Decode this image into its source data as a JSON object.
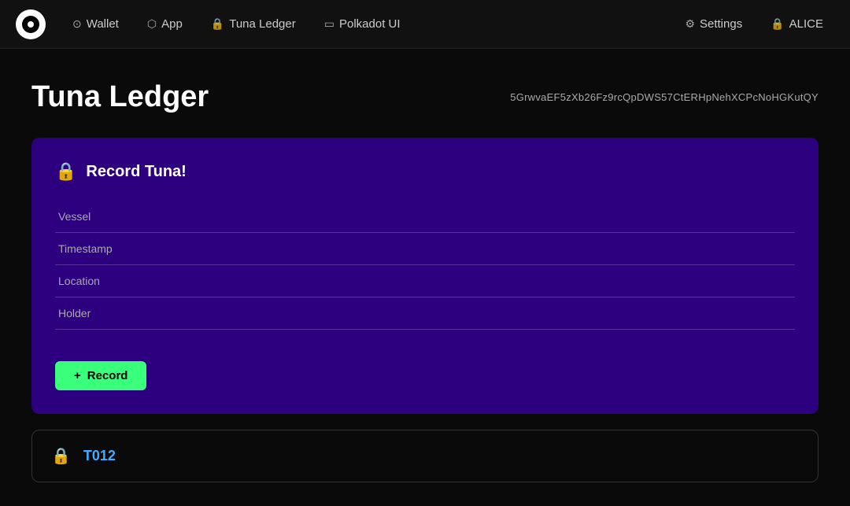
{
  "nav": {
    "logo_alt": "Polkadot Logo",
    "items": [
      {
        "id": "wallet",
        "label": "Wallet",
        "icon": "⊙"
      },
      {
        "id": "app",
        "label": "App",
        "icon": "⬡"
      },
      {
        "id": "tuna-ledger",
        "label": "Tuna Ledger",
        "icon": "🔒"
      },
      {
        "id": "polkadot-ui",
        "label": "Polkadot UI",
        "icon": "▭"
      }
    ],
    "right_items": [
      {
        "id": "settings",
        "label": "Settings",
        "icon": "⚙"
      },
      {
        "id": "alice",
        "label": "ALICE",
        "icon": "🔒"
      }
    ]
  },
  "page": {
    "title": "Tuna Ledger",
    "address": "5GrwvaEF5zXb26Fz9rcQpDWS57CtERHpNehXCPcNoHGKutQY"
  },
  "form": {
    "title": "Record Tuna!",
    "icon": "🔒",
    "fields": [
      {
        "id": "vessel",
        "placeholder": "Vessel"
      },
      {
        "id": "timestamp",
        "placeholder": "Timestamp"
      },
      {
        "id": "location",
        "placeholder": "Location"
      },
      {
        "id": "holder",
        "placeholder": "Holder"
      }
    ],
    "submit_label": "Record",
    "submit_icon": "+"
  },
  "records": [
    {
      "id": "T012",
      "icon": "🔒"
    }
  ]
}
